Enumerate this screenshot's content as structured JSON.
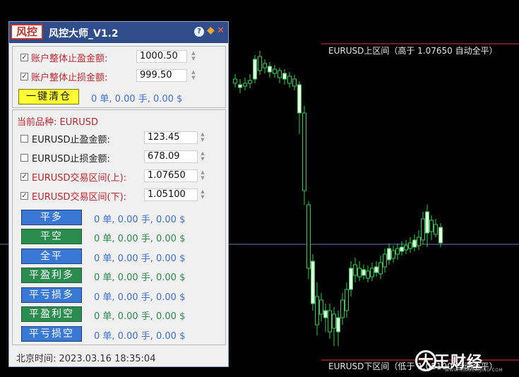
{
  "chart": {
    "upper_line_label": "EURUSD上区间（高于 1.07650 自动全平）",
    "lower_line_label": "EURUSD下区间（低于 1.05100 自动全平）",
    "upper_line_color": "#e0383e",
    "mid_line_color": "#5b7fb0"
  },
  "panel": {
    "logo_text": "风控",
    "title": "风控大师_V1.2",
    "help": "?",
    "minimize": "◆",
    "close": "✕",
    "account": {
      "tp_label": "账户整体止盈金额:",
      "tp_value": "1000.50",
      "tp_checked": true,
      "sl_label": "账户整体止损金额:",
      "sl_value": "999.50",
      "sl_checked": true,
      "close_all_button": "一键清仓",
      "close_all_stat": "0 单, 0.00 手, 0.00 $"
    },
    "symbol": {
      "current_label": "当前品种: EURUSD",
      "tp_label": "EURUSD止盈金额:",
      "tp_value": "123.45",
      "tp_checked": false,
      "sl_label": "EURUSD止损金额:",
      "sl_value": "678.09",
      "sl_checked": false,
      "upper_label": "EURUSD交易区间(上):",
      "upper_value": "1.07650",
      "upper_checked": true,
      "lower_label": "EURUSD交易区间(下):",
      "lower_value": "1.05100",
      "lower_checked": true
    },
    "actions": [
      {
        "label": "平多",
        "stat": "0 单, 0.00 手, 0.00 $",
        "color": "blue"
      },
      {
        "label": "平空",
        "stat": "0 单, 0.00 手, 0.00 $",
        "color": "green"
      },
      {
        "label": "全平",
        "stat": "0 单, 0.00 手, 0.00 $",
        "color": "blue"
      },
      {
        "label": "平盈利多",
        "stat": "0 单, 0.00 手, 0.00 $",
        "color": "green"
      },
      {
        "label": "平亏损多",
        "stat": "0 单, 0.00 手, 0.00 $",
        "color": "blue"
      },
      {
        "label": "平盈利空",
        "stat": "0 单, 0.00 手, 0.00 $",
        "color": "green"
      },
      {
        "label": "平亏损空",
        "stat": "0 单, 0.00 手, 0.00 $",
        "color": "blue"
      }
    ],
    "footer_time": "北京时间: 2023.03.16 18:35:04"
  },
  "watermark": {
    "brand": "大王财经",
    "url": "WWW.KINGCAIJING.COM"
  }
}
